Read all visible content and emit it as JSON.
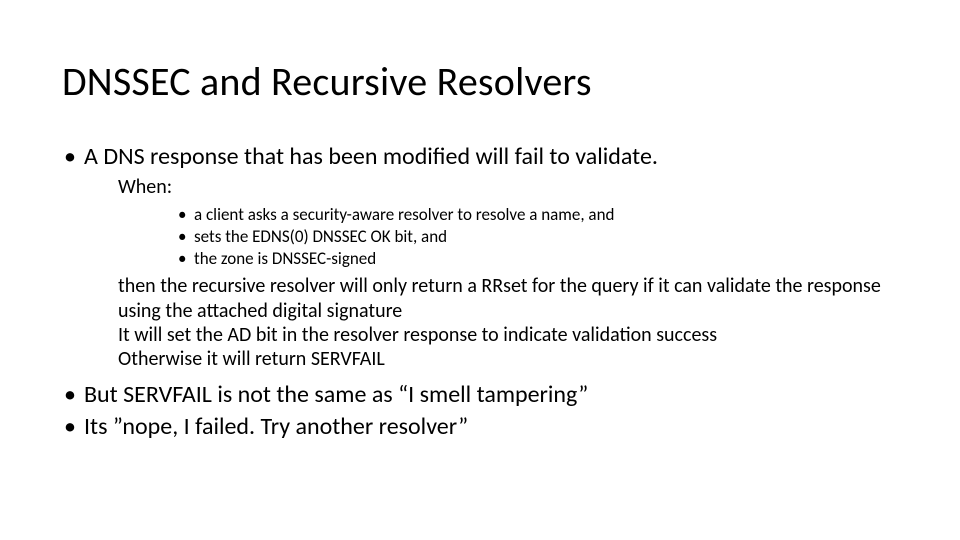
{
  "title": "DNSSEC and Recursive Resolvers",
  "bullets": {
    "b1": "A DNS response that has been modified will fail to validate.",
    "when": "When:",
    "c1": "a client asks a security-aware resolver to resolve a name, and",
    "c2": "sets the EDNS(0) DNSSEC OK bit, and",
    "c3": "the zone is DNSSEC-signed",
    "then1": "then the recursive resolver will only return a RRset for the query if it can validate the response using the attached digital signature",
    "then2": "It will set the AD bit in the resolver response to indicate validation success",
    "then3": "Otherwise it will return SERVFAIL",
    "b2": "But SERVFAIL is not the same as “I smell tampering”",
    "b3": "Its ”nope, I failed. Try another resolver”"
  }
}
